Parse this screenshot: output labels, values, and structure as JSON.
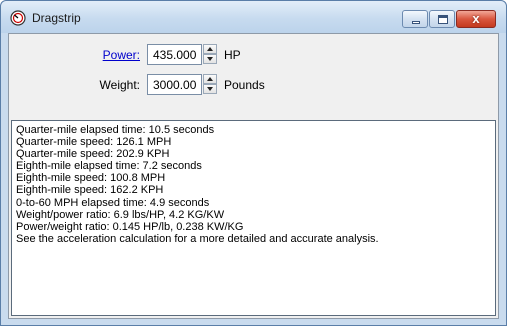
{
  "window": {
    "title": "Dragstrip",
    "close_glyph": "x"
  },
  "inputs": {
    "power": {
      "label": "Power:",
      "value": "435.000",
      "unit": "HP"
    },
    "weight": {
      "label": "Weight:",
      "value": "3000.00",
      "unit": "Pounds"
    }
  },
  "results": [
    "Quarter-mile elapsed time: 10.5 seconds",
    "Quarter-mile speed: 126.1 MPH",
    "Quarter-mile speed: 202.9 KPH",
    "Eighth-mile elapsed time: 7.2 seconds",
    "Eighth-mile speed: 100.8 MPH",
    "Eighth-mile speed: 162.2 KPH",
    "0-to-60 MPH elapsed time: 4.9 seconds",
    "Weight/power ratio: 6.9 lbs/HP, 4.2 KG/KW",
    "Power/weight ratio: 0.145 HP/lb, 0.238 KW/KG",
    "See the acceleration calculation for a more detailed and accurate analysis."
  ]
}
